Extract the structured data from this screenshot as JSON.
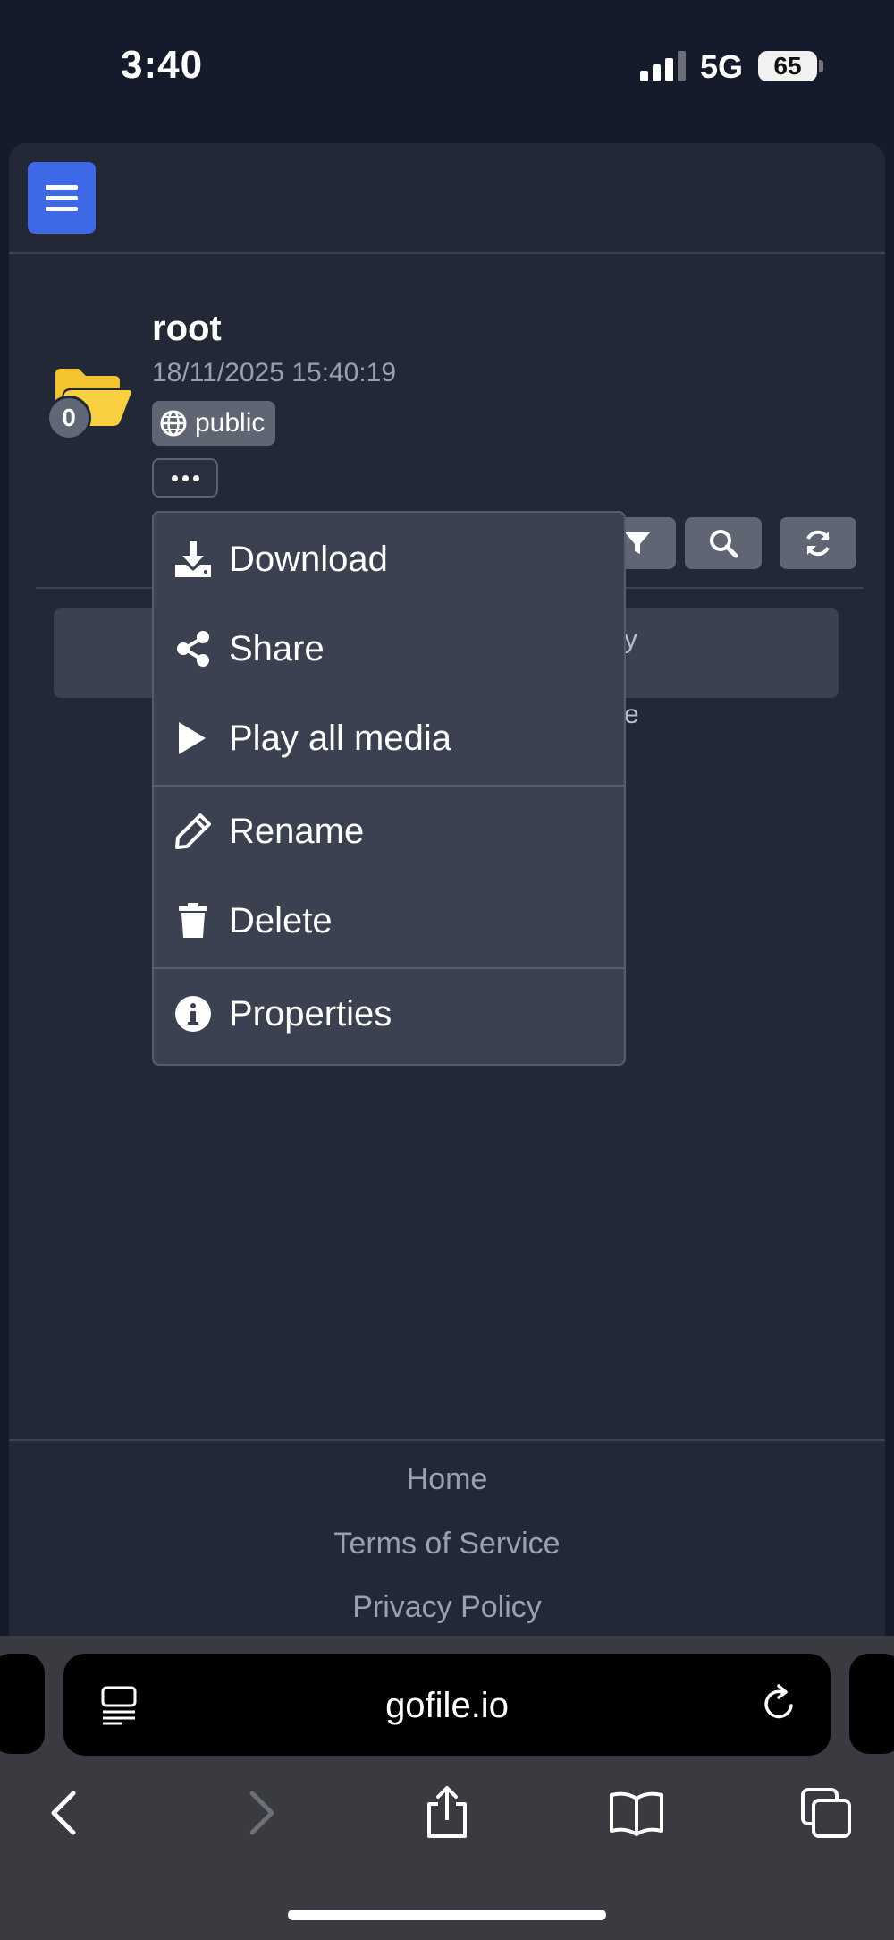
{
  "status_bar": {
    "time": "3:40",
    "network": "5G",
    "battery": "65"
  },
  "folder": {
    "name": "root",
    "date": "18/11/2025 15:40:19",
    "visibility": "public",
    "count": "0"
  },
  "hidden_text": {
    "fragment_1": "y",
    "fragment_2": "e"
  },
  "menu": {
    "items": [
      {
        "label": "Download",
        "icon": "download-icon"
      },
      {
        "label": "Share",
        "icon": "share-icon"
      },
      {
        "label": "Play all media",
        "icon": "play-icon"
      },
      {
        "label": "Rename",
        "icon": "pencil-icon"
      },
      {
        "label": "Delete",
        "icon": "trash-icon"
      },
      {
        "label": "Properties",
        "icon": "info-icon"
      }
    ]
  },
  "footer": {
    "links": [
      "Home",
      "Terms of Service",
      "Privacy Policy"
    ]
  },
  "browser": {
    "url": "gofile.io"
  },
  "colors": {
    "accent": "#3d68e8",
    "folder": "#f4c430",
    "background": "#222836",
    "menu": "#3c4151"
  }
}
